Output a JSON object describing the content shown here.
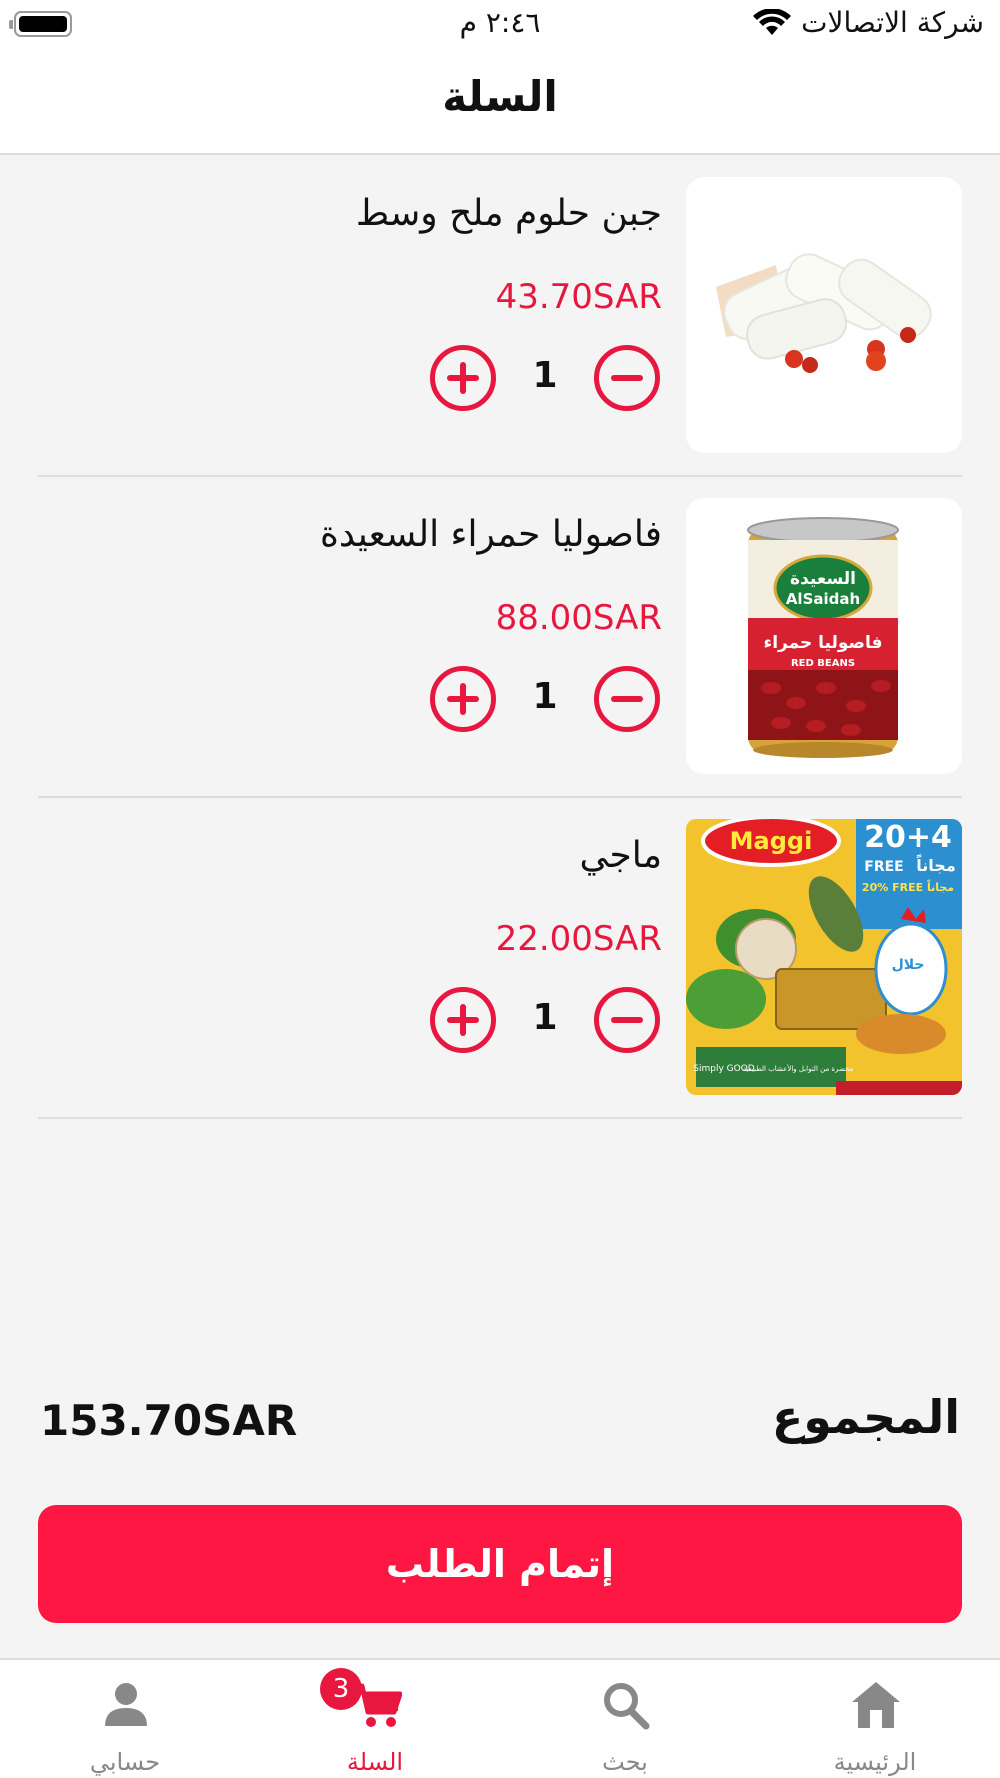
{
  "status_bar": {
    "time": "٢:٤٦ م",
    "carrier": "شركة الاتصالات"
  },
  "header": {
    "title": "السلة"
  },
  "cart": {
    "items": [
      {
        "name": "جبن حلوم ملح وسط",
        "price": "43.70SAR",
        "quantity": "1",
        "image_icon": "halloumi-cheese-image"
      },
      {
        "name": "فاصوليا حمراء السعيدة",
        "price": "88.00SAR",
        "quantity": "1",
        "image_icon": "red-beans-can-image",
        "image_text": {
          "brand_ar": "السعيدة",
          "brand_en": "AlSaidah",
          "product_ar": "فاصوليا حمراء",
          "product_en": "RED BEANS"
        }
      },
      {
        "name": "ماجي",
        "price": "22.00SAR",
        "quantity": "1",
        "image_icon": "maggi-box-image",
        "image_text": {
          "brand": "Maggi",
          "promo": "20+4",
          "free": "FREE",
          "free_ar": "مجاناً",
          "free_percent": "20% FREE مجاناً",
          "halal": "حلال",
          "simply_good": "Simply GOOD",
          "natural_ar": "محضرة من التوابل والأعشاب الطبيعية"
        }
      }
    ]
  },
  "summary": {
    "total_label": "المجموع",
    "total_value": "153.70SAR"
  },
  "checkout": {
    "label": "إتمام الطلب"
  },
  "tabs": [
    {
      "label": "الرئيسية",
      "icon": "home-icon"
    },
    {
      "label": "بحث",
      "icon": "search-icon"
    },
    {
      "label": "السلة",
      "icon": "cart-icon",
      "badge": "3"
    },
    {
      "label": "حسابي",
      "icon": "user-icon"
    }
  ],
  "colors": {
    "accent": "#e8173f",
    "button": "#ff1744",
    "inactive": "#888888"
  }
}
